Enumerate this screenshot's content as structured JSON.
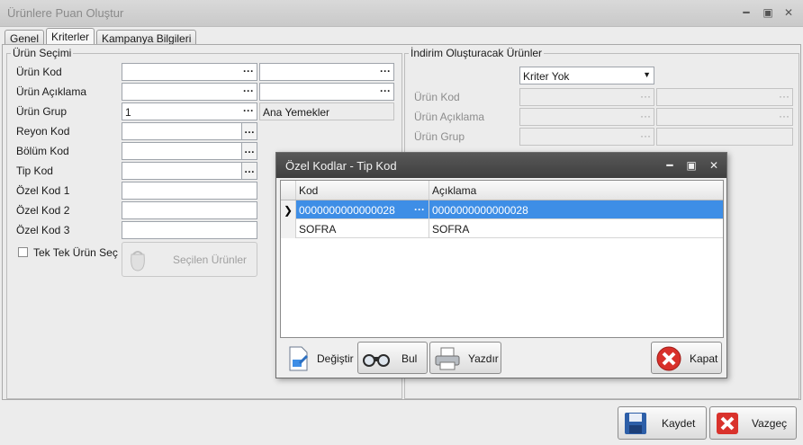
{
  "window": {
    "title": "Ürünlere Puan Oluştur",
    "tabs": [
      {
        "label": "Genel"
      },
      {
        "label": "Kriterler"
      },
      {
        "label": "Kampanya Bilgileri"
      }
    ]
  },
  "urun_secimi": {
    "legend": "Ürün Seçimi",
    "rows": [
      {
        "label": "Ürün Kod",
        "value1": "",
        "value2": ""
      },
      {
        "label": "Ürün Açıklama",
        "value1": "",
        "value2": ""
      },
      {
        "label": "Ürün Grup",
        "value1": "1",
        "value2": "Ana Yemekler"
      },
      {
        "label": "Reyon Kod",
        "value1": ""
      },
      {
        "label": "Bölüm Kod",
        "value1": ""
      },
      {
        "label": "Tip Kod",
        "value1": ""
      },
      {
        "label": "Özel Kod 1",
        "value1": ""
      },
      {
        "label": "Özel Kod 2",
        "value1": ""
      },
      {
        "label": "Özel Kod 3",
        "value1": ""
      }
    ],
    "checkbox_label": "Tek Tek Ürün Seç",
    "selected_products_button": "Seçilen Ürünler"
  },
  "indirim": {
    "legend": "İndirim Oluşturacak Ürünler",
    "criteria_select": "Kriter Yok",
    "rows": [
      {
        "label": "Ürün Kod"
      },
      {
        "label": "Ürün Açıklama"
      },
      {
        "label": "Ürün Grup"
      }
    ]
  },
  "dialog": {
    "title": "Özel Kodlar - Tip Kod",
    "columns": [
      "Kod",
      "Açıklama"
    ],
    "rows": [
      {
        "kod": "0000000000000028",
        "aciklama": "0000000000000028"
      },
      {
        "kod": "SOFRA",
        "aciklama": "SOFRA"
      }
    ],
    "buttons": {
      "degistir": "Değiştir",
      "bul": "Bul",
      "yazdir": "Yazdır",
      "kapat": "Kapat"
    }
  },
  "footer": {
    "kaydet": "Kaydet",
    "vazgec": "Vazgeç"
  },
  "colors": {
    "selection": "#3e8ee6",
    "dialog_title": "#4a4a4a"
  }
}
